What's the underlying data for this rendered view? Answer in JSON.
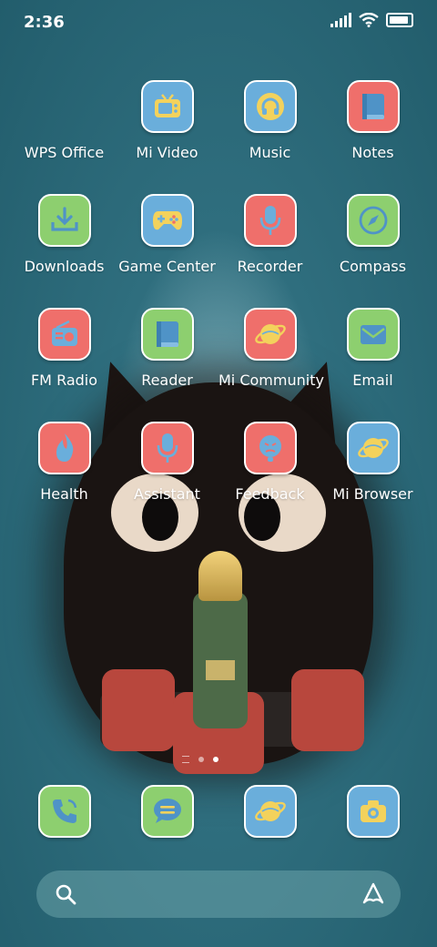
{
  "status_bar": {
    "time": "2:36"
  },
  "rows": [
    [
      {
        "label": "WPS Office",
        "icon": "wps-office-icon",
        "color": "none"
      },
      {
        "label": "Mi Video",
        "icon": "tv-icon",
        "color": "blue"
      },
      {
        "label": "Music",
        "icon": "headphones-icon",
        "color": "blue"
      },
      {
        "label": "Notes",
        "icon": "book-icon",
        "color": "red"
      }
    ],
    [
      {
        "label": "Downloads",
        "icon": "download-icon",
        "color": "green"
      },
      {
        "label": "Game Center",
        "icon": "gamepad-icon",
        "color": "blue"
      },
      {
        "label": "Recorder",
        "icon": "microphone-icon",
        "color": "red"
      },
      {
        "label": "Compass",
        "icon": "compass-icon",
        "color": "green"
      }
    ],
    [
      {
        "label": "FM Radio",
        "icon": "radio-icon",
        "color": "red"
      },
      {
        "label": "Reader",
        "icon": "book-icon",
        "color": "green"
      },
      {
        "label": "Mi Community",
        "icon": "planet-icon",
        "color": "red"
      },
      {
        "label": "Email",
        "icon": "envelope-icon",
        "color": "green"
      }
    ],
    [
      {
        "label": "Health",
        "icon": "flame-icon",
        "color": "red"
      },
      {
        "label": "Assistant",
        "icon": "microphone-icon",
        "color": "red"
      },
      {
        "label": "Feedback",
        "icon": "face-icon",
        "color": "red"
      },
      {
        "label": "Mi Browser",
        "icon": "planet-icon",
        "color": "blue"
      }
    ]
  ],
  "dock": [
    {
      "icon": "phone-icon",
      "color": "green"
    },
    {
      "icon": "message-icon",
      "color": "green"
    },
    {
      "icon": "planet-icon",
      "color": "blue"
    },
    {
      "icon": "camera-icon",
      "color": "blue"
    }
  ],
  "page_indicator": {
    "pages": 2,
    "active": 1
  }
}
